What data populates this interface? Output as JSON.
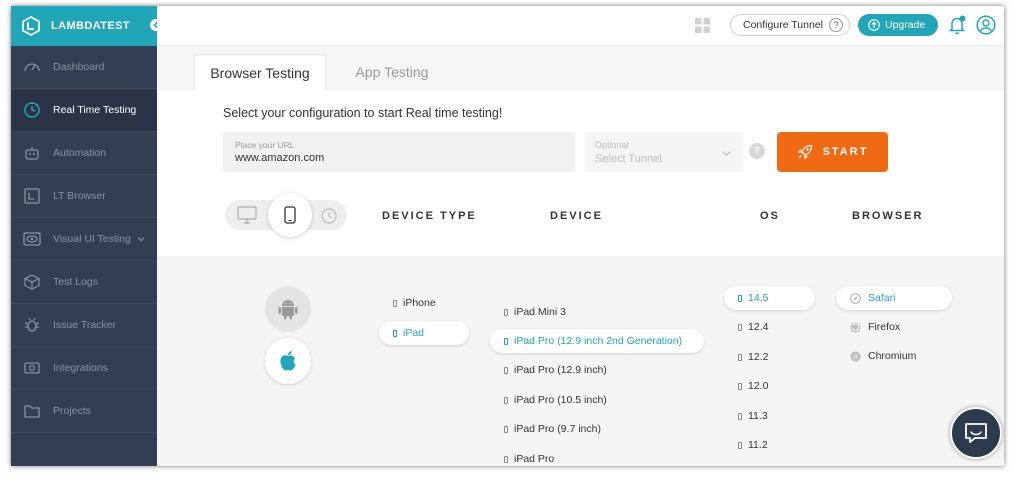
{
  "brand": {
    "name": "LAMBDATEST"
  },
  "sidebar": {
    "items": [
      {
        "label": "Dashboard",
        "icon": "dashboard-icon"
      },
      {
        "label": "Real Time Testing",
        "icon": "clock-icon",
        "active": true
      },
      {
        "label": "Automation",
        "icon": "robot-icon"
      },
      {
        "label": "LT Browser",
        "icon": "lt-browser-icon"
      },
      {
        "label": "Visual UI Testing",
        "icon": "eye-icon",
        "has_submenu": true
      },
      {
        "label": "Test Logs",
        "icon": "cube-icon"
      },
      {
        "label": "Issue Tracker",
        "icon": "bug-icon"
      },
      {
        "label": "Integrations",
        "icon": "plug-icon"
      },
      {
        "label": "Projects",
        "icon": "folder-icon"
      }
    ]
  },
  "header": {
    "configure_tunnel": "Configure Tunnel",
    "help": "?",
    "upgrade": "Upgrade"
  },
  "tabs": [
    {
      "label": "Browser Testing",
      "active": true
    },
    {
      "label": "App Testing",
      "active": false
    }
  ],
  "config": {
    "prompt": "Select your configuration to start Real time testing!",
    "url": {
      "label": "Place your URL",
      "value": "www.amazon.com"
    },
    "tunnel": {
      "label": "Optional",
      "value": "Select Tunnel"
    },
    "help": "?",
    "start": "START"
  },
  "columns": {
    "device_type": "DEVICE TYPE",
    "device": "DEVICE",
    "os": "OS",
    "browser": "BROWSER"
  },
  "device_types": [
    "iPhone",
    "iPad"
  ],
  "selected_device_type": "iPad",
  "devices": [
    "iPad Mini 3",
    "iPad Pro (12.9 inch 2nd Generation)",
    "iPad Pro (12.9 inch)",
    "iPad Pro (10.5 inch)",
    "iPad Pro (9.7 inch)",
    "iPad Pro"
  ],
  "selected_device": "iPad Pro (12.9 inch 2nd Generation)",
  "os_versions": [
    "14.5",
    "12.4",
    "12.2",
    "12.0",
    "11.3",
    "11.2"
  ],
  "selected_os": "14.5",
  "browsers": [
    {
      "label": "Safari",
      "icon": "safari-icon"
    },
    {
      "label": "Firefox",
      "icon": "firefox-icon"
    },
    {
      "label": "Chromium",
      "icon": "chromium-icon"
    }
  ],
  "selected_browser": "Safari",
  "colors": {
    "accent": "#21a6b8",
    "start": "#f06a14",
    "sidebar": "#333e52"
  }
}
